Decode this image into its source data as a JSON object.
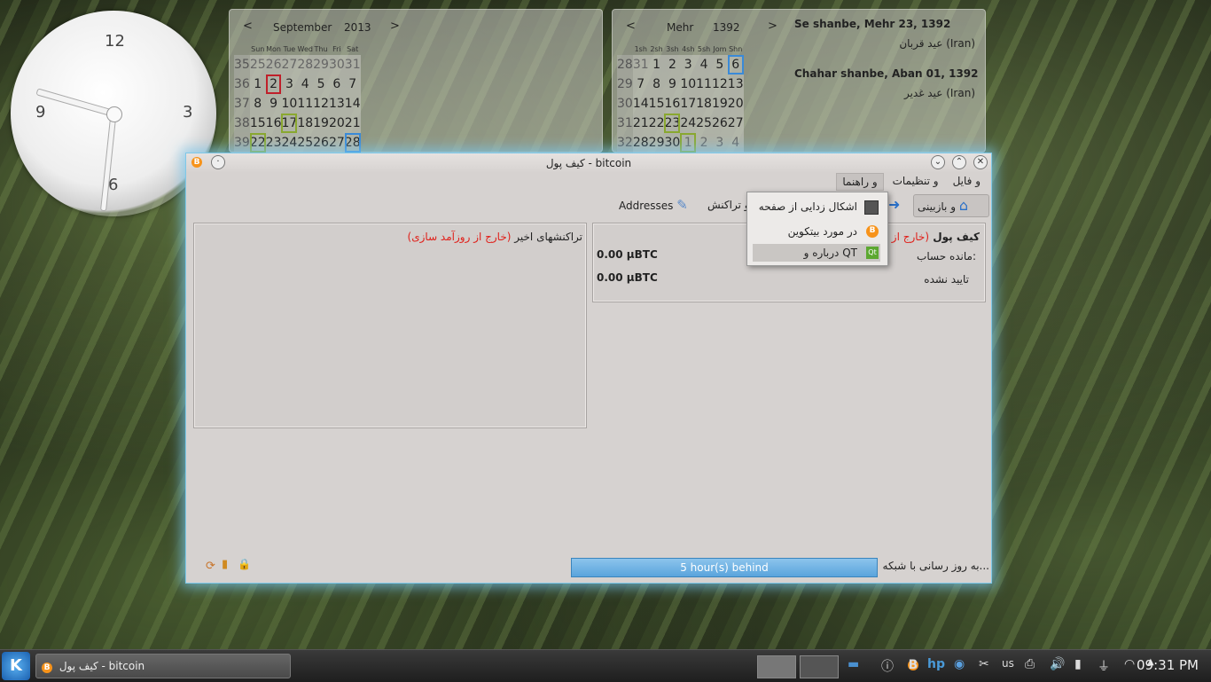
{
  "clock": {
    "n12": "12",
    "n3": "3",
    "n6": "6",
    "n9": "9"
  },
  "gregorian": {
    "month": "September",
    "year": "2013",
    "prev": "<",
    "next": ">",
    "days": [
      "Sun",
      "Mon",
      "Tue",
      "Wed",
      "Thu",
      "Fri",
      "Sat"
    ],
    "rows": [
      [
        "35",
        "25",
        "26",
        "27",
        "28",
        "29",
        "30",
        "31"
      ],
      [
        "36",
        "1",
        "2",
        "3",
        "4",
        "5",
        "6",
        "7"
      ],
      [
        "37",
        "8",
        "9",
        "10",
        "11",
        "12",
        "13",
        "14"
      ],
      [
        "38",
        "15",
        "16",
        "17",
        "18",
        "19",
        "20",
        "21"
      ],
      [
        "39",
        "22",
        "23",
        "24",
        "25",
        "26",
        "27",
        "28"
      ]
    ]
  },
  "persian": {
    "month": "Mehr",
    "year": "1392",
    "prev": "<",
    "next": ">",
    "days": [
      "1sh",
      "2sh",
      "3sh",
      "4sh",
      "5sh",
      "Jom",
      "Shn"
    ],
    "rows": [
      [
        "28",
        "31",
        "1",
        "2",
        "3",
        "4",
        "5",
        "6"
      ],
      [
        "29",
        "7",
        "8",
        "9",
        "10",
        "11",
        "12",
        "13"
      ],
      [
        "30",
        "14",
        "15",
        "16",
        "17",
        "18",
        "19",
        "20"
      ],
      [
        "31",
        "21",
        "22",
        "23",
        "24",
        "25",
        "26",
        "27"
      ],
      [
        "32",
        "28",
        "29",
        "30",
        "1",
        "2",
        "3",
        "4"
      ]
    ]
  },
  "events": [
    {
      "date": "Se shanbe, Mehr 23, 1392",
      "item": "عید قربان (Iran)"
    },
    {
      "date": "Chahar shanbe, Aban 01, 1392",
      "item": "عید غدیر (Iran)"
    }
  ],
  "window": {
    "title": "کیف پول - bitcoin",
    "menu": [
      "و فایل",
      "و تنظیمات",
      "و راهنما"
    ],
    "toolbar": {
      "overview": "و بازبینی",
      "transactions": "و تراکنش",
      "addresses": "Addresses"
    },
    "wallet": {
      "heading": "کیف پول",
      "out_of_sync": "(خارج از روزآمد سازی)",
      "balance_label": "مانده حساب:",
      "balance": "0.00 µBTC",
      "unconfirmed_label": "تایید نشده",
      "unconfirmed": "0.00 µBTC"
    },
    "recent": {
      "heading": "تراکنشهای اخیر",
      "out_of_sync": "(خارج از روزآمد سازی)"
    },
    "status": {
      "text": "به روز رسانی با شبکه...",
      "progress_text": "5 hour(s) behind",
      "progress": 1.0
    }
  },
  "popup": {
    "items": [
      "اشکال زدایی از صفحه",
      "در مورد بیتکوین",
      "درباره و QT"
    ]
  },
  "taskbar": {
    "task": "کیف پول - bitcoin",
    "layout": "us",
    "time": "09:31 PM"
  }
}
